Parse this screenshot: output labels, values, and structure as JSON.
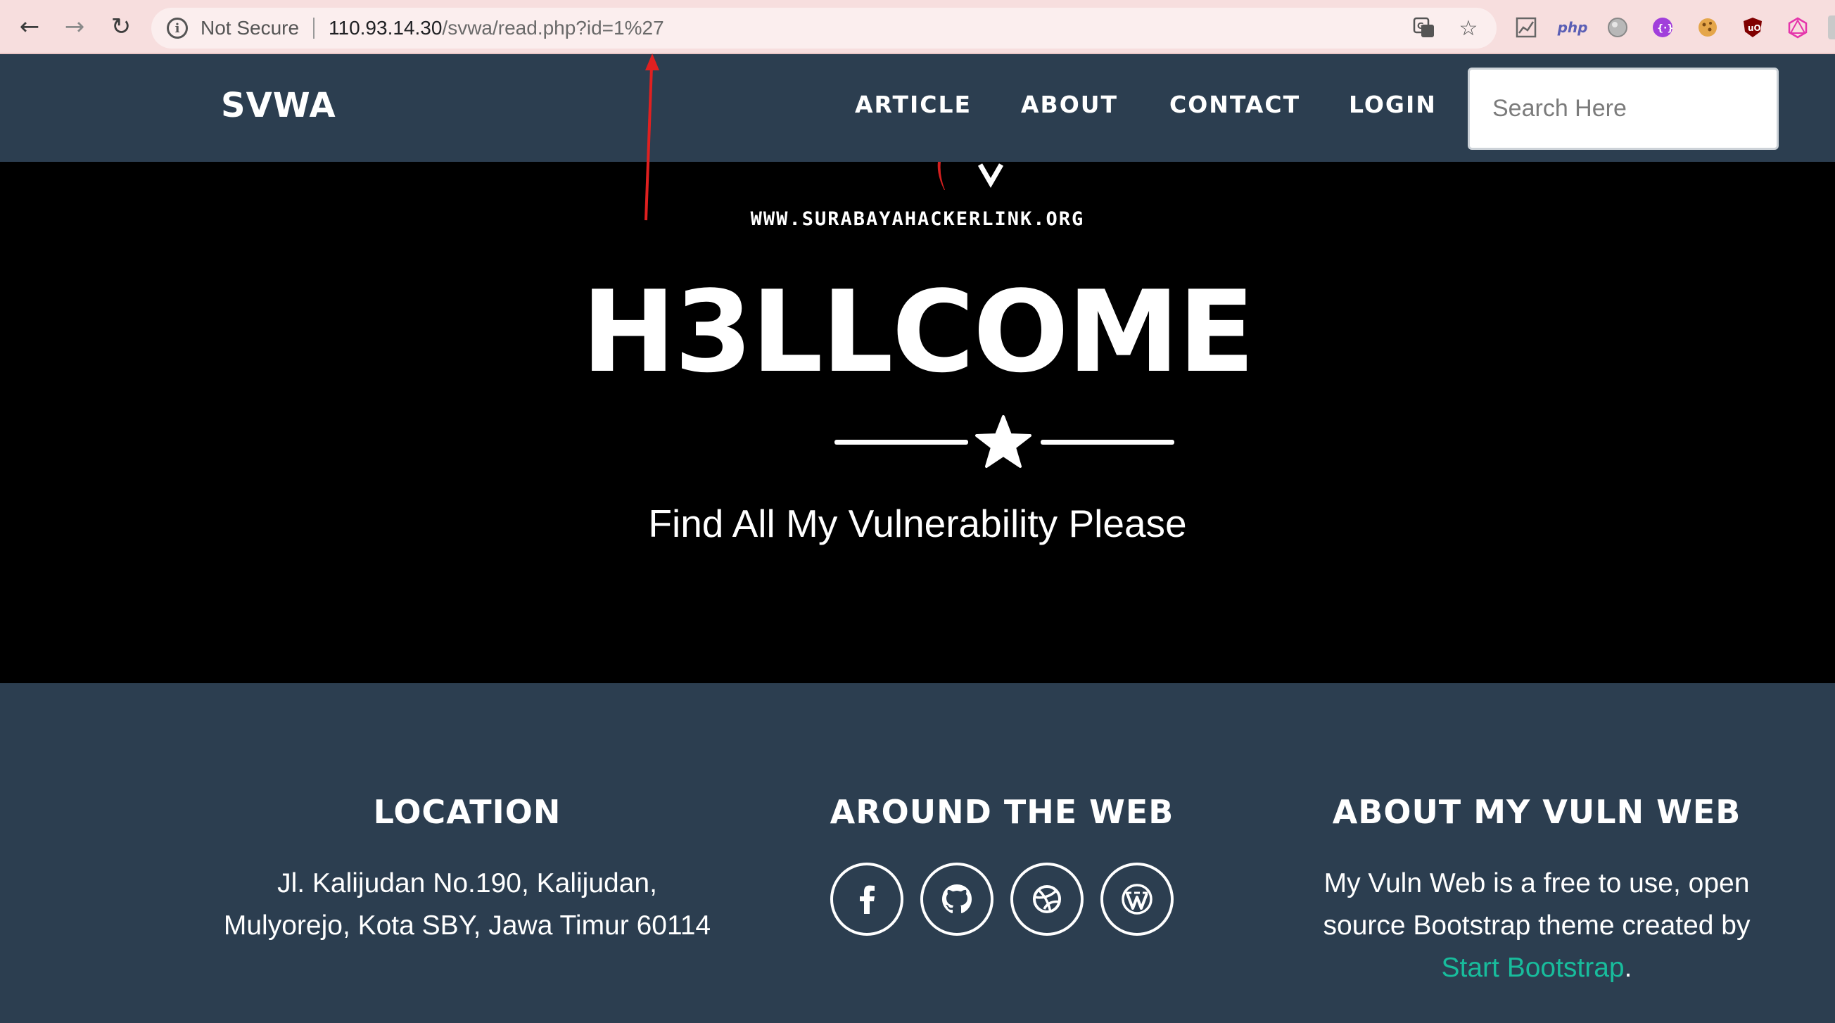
{
  "browser": {
    "security_label": "Not Secure",
    "url_host": "110.93.14.30",
    "url_path": "/svwa/read.php?id=1%27",
    "extension_php_label": "php"
  },
  "navbar": {
    "brand": "SVWA",
    "links": [
      "ARTICLE",
      "ABOUT",
      "CONTACT",
      "LOGIN"
    ],
    "search_placeholder": "Search Here"
  },
  "hero": {
    "site_url": "WWW.SURABAYAHACKERLINK.ORG",
    "title": "H3LLCOME",
    "subtitle": "Find All My Vulnerability Please"
  },
  "footer": {
    "location": {
      "heading": "LOCATION",
      "line1": "Jl. Kalijudan No.190, Kalijudan,",
      "line2": "Mulyorejo, Kota SBY, Jawa Timur 60114"
    },
    "around": {
      "heading": "AROUND THE WEB",
      "icons": [
        "facebook-icon",
        "github-icon",
        "dribbble-icon",
        "wordpress-icon"
      ]
    },
    "about": {
      "heading": "ABOUT MY VULN WEB",
      "text_before": "My Vuln Web is a free to use, open source Bootstrap theme created by",
      "link": "Start Bootstrap",
      "text_after": "."
    }
  },
  "colors": {
    "navbar_bg": "#2c3e50",
    "hero_bg": "#000000",
    "link_accent": "#18bc9c",
    "annotation_arrow": "#e02020"
  }
}
